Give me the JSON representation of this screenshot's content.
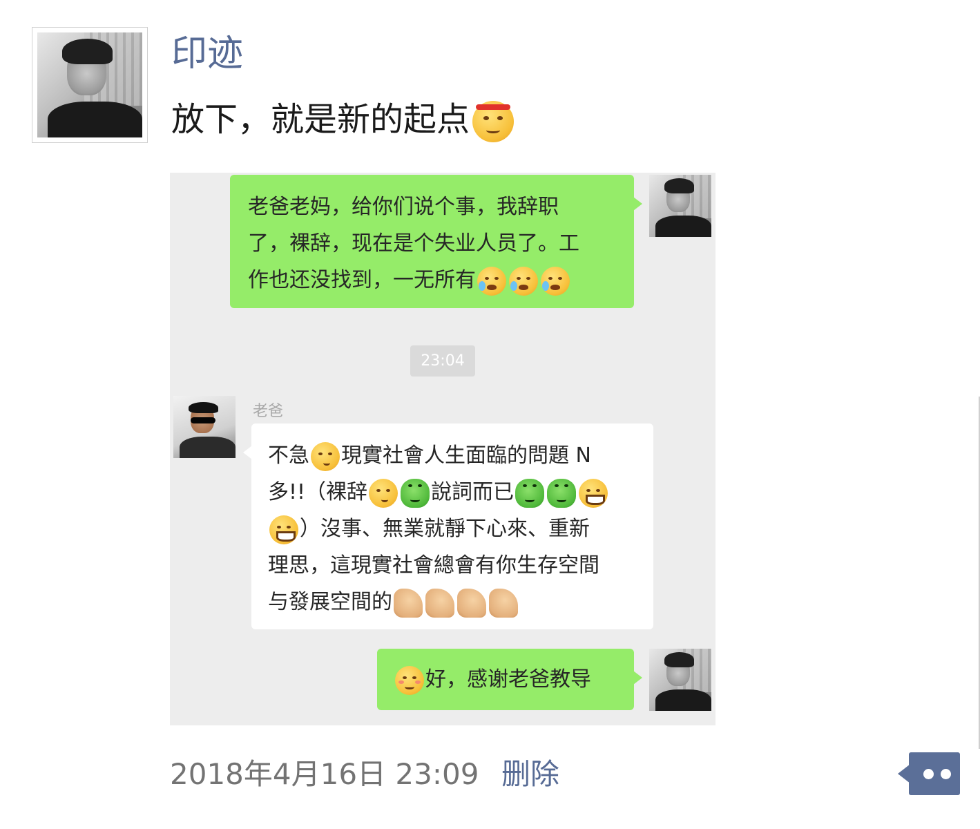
{
  "post": {
    "author": "印迹",
    "text": "放下，就是新的起点",
    "text_emoji": "angry-face-icon"
  },
  "screenshot": {
    "messages": [
      {
        "side": "right",
        "text": "老爸老妈，给你们说个事，我辞职了，裸辞，现在是个失业人员了。工作也还没找到，一无所有",
        "lines": [
          "老爸老妈，给你们说个事，我辞职",
          "了，裸辞，现在是个失业人员了。工",
          "作也还没找到，一无所有"
        ],
        "trailing_emoji": [
          "crying-face-icon",
          "crying-face-icon",
          "crying-face-icon"
        ]
      },
      {
        "side": "left",
        "sender": "老爸",
        "line1": [
          "不急",
          "現實社會人生面臨的問題 N"
        ],
        "line2": [
          "多!!（裸辞",
          "說詞而已"
        ],
        "line3": [
          "）沒事、無業就靜下心來、重新"
        ],
        "line4": "理思，這現實社會總會有你生存空間",
        "line5": "与發展空間的",
        "muscle_count": 4
      },
      {
        "side": "right",
        "text": "好，感谢老爸教导",
        "leading_emoji": "shy-smile-icon"
      }
    ],
    "time_divider": "23:04"
  },
  "footer": {
    "timestamp": "2018年4月16日 23:09",
    "delete_label": "删除"
  },
  "colors": {
    "link_blue": "#576b95",
    "bubble_green": "#95ec69",
    "chat_bg": "#ededed",
    "more_button": "#5b6f98"
  }
}
